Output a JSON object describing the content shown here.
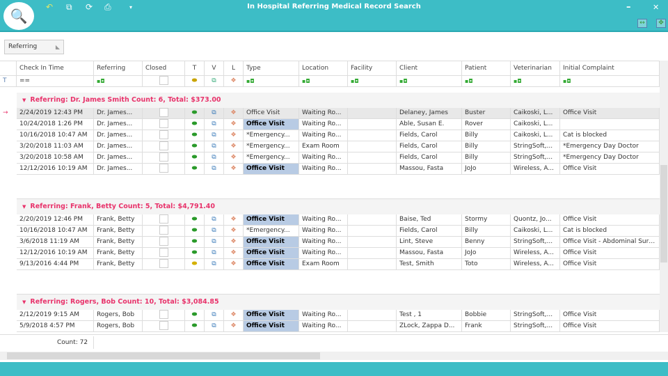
{
  "window": {
    "title": "In Hospital Referring Medical Record Search",
    "minimize": "–",
    "close": "✕"
  },
  "toolbar": {
    "icons": [
      "undo-icon",
      "visit-icon",
      "refresh-icon",
      "print-icon",
      "dropdown-icon"
    ]
  },
  "group_panel": {
    "label": "Referring"
  },
  "columns": [
    "",
    "Check In Time",
    "Referring",
    "Closed",
    "T",
    "V",
    "L",
    "Type",
    "Location",
    "Facility",
    "Client",
    "Patient",
    "Veterinarian",
    "Initial Complaint"
  ],
  "filter": {
    "check_in": "=="
  },
  "groups": [
    {
      "header": "Referring: Dr. James Smith Count: 6, Total: $373.00",
      "rows": [
        {
          "time": "2/24/2019 12:43 PM",
          "ref": "Dr. James...",
          "type": "Office Visit",
          "type_hl": false,
          "loc": "Waiting Ro...",
          "client": "Delaney, James",
          "patient": "Buster",
          "vet": "Caikoski, L...",
          "complaint": "Office Visit",
          "t": "green",
          "current": true
        },
        {
          "time": "10/24/2018 1:26 PM",
          "ref": "Dr. James...",
          "type": "Office Visit",
          "type_hl": true,
          "loc": "Waiting Ro...",
          "client": "Able, Susan E.",
          "patient": "Rover",
          "vet": "Caikoski, L...",
          "complaint": "",
          "t": "green"
        },
        {
          "time": "10/16/2018 10:47 AM",
          "ref": "Dr. James...",
          "type": "*Emergency...",
          "type_hl": false,
          "loc": "Waiting Ro...",
          "client": "Fields, Carol",
          "patient": "Billy",
          "vet": "Caikoski, L...",
          "complaint": "Cat is blocked",
          "t": "green"
        },
        {
          "time": "3/20/2018 11:03 AM",
          "ref": "Dr. James...",
          "type": "*Emergency...",
          "type_hl": false,
          "loc": "Exam Room",
          "client": "Fields, Carol",
          "patient": "Billy",
          "vet": "StringSoft,...",
          "complaint": "*Emergency Day Doctor",
          "t": "green"
        },
        {
          "time": "3/20/2018 10:58 AM",
          "ref": "Dr. James...",
          "type": "*Emergency...",
          "type_hl": false,
          "loc": "Waiting Ro...",
          "client": "Fields, Carol",
          "patient": "Billy",
          "vet": "StringSoft,...",
          "complaint": "*Emergency Day Doctor",
          "t": "green"
        },
        {
          "time": "12/12/2016 10:19 AM",
          "ref": "Dr. James...",
          "type": "Office Visit",
          "type_hl": true,
          "loc": "Waiting Ro...",
          "client": "Massou, Fasta",
          "patient": "JoJo",
          "vet": "Wireless, A...",
          "complaint": "Office Visit",
          "t": "green"
        }
      ]
    },
    {
      "header": "Referring: Frank, Betty Count: 5, Total: $4,791.40",
      "rows": [
        {
          "time": "2/20/2019 12:46 PM",
          "ref": "Frank, Betty",
          "type": "Office Visit",
          "type_hl": true,
          "loc": "Waiting Ro...",
          "client": "Baise, Ted",
          "patient": "Stormy",
          "vet": "Quontz, Jo...",
          "complaint": "Office Visit",
          "t": "green"
        },
        {
          "time": "10/16/2018 10:47 AM",
          "ref": "Frank, Betty",
          "type": "*Emergency...",
          "type_hl": false,
          "loc": "Waiting Ro...",
          "client": "Fields, Carol",
          "patient": "Billy",
          "vet": "Caikoski, L...",
          "complaint": "Cat is blocked",
          "t": "green"
        },
        {
          "time": "3/6/2018 11:19 AM",
          "ref": "Frank, Betty",
          "type": "Office Visit",
          "type_hl": true,
          "loc": "Waiting Ro...",
          "client": "Lint, Steve",
          "patient": "Benny",
          "vet": "StringSoft,...",
          "complaint": "Office Visit - Abdominal Surgery",
          "t": "green"
        },
        {
          "time": "12/12/2016 10:19 AM",
          "ref": "Frank, Betty",
          "type": "Office Visit",
          "type_hl": true,
          "loc": "Waiting Ro...",
          "client": "Massou, Fasta",
          "patient": "JoJo",
          "vet": "Wireless, A...",
          "complaint": "Office Visit",
          "t": "green"
        },
        {
          "time": "9/13/2016 4:44 PM",
          "ref": "Frank, Betty",
          "type": "Office Visit",
          "type_hl": true,
          "loc": "Exam Room",
          "client": "Test, Smith",
          "patient": "Toto",
          "vet": "Wireless, A...",
          "complaint": "Office Visit",
          "t": "yellow"
        }
      ]
    },
    {
      "header": "Referring: Rogers, Bob Count: 10, Total: $3,084.85",
      "rows": [
        {
          "time": "2/12/2019 9:15 AM",
          "ref": "Rogers, Bob",
          "type": "Office Visit",
          "type_hl": true,
          "loc": "Waiting Ro...",
          "client": "Test , 1",
          "patient": "Bobbie",
          "vet": "StringSoft,...",
          "complaint": "Office Visit",
          "t": "green"
        },
        {
          "time": "5/9/2018 4:57 PM",
          "ref": "Rogers, Bob",
          "type": "Office Visit",
          "type_hl": true,
          "loc": "Waiting Ro...",
          "client": "ZLock, Zappa D...",
          "patient": "Frank",
          "vet": "StringSoft,...",
          "complaint": "Office Visit",
          "t": "green"
        }
      ]
    }
  ],
  "footer": {
    "count_label": "Count:",
    "count": "72"
  },
  "colors": {
    "titlebar": "#3dbdc6",
    "group_header": "#e8336b",
    "type_highlight": "#b8cbe4"
  }
}
